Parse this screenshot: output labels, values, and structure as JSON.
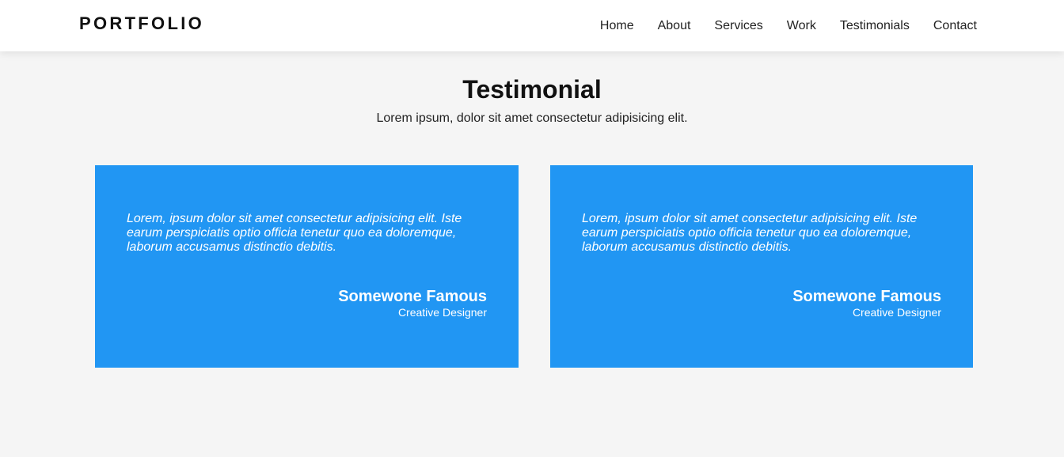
{
  "nav": {
    "logo": "PORTFOLIO",
    "links": [
      "Home",
      "About",
      "Services",
      "Work",
      "Testimonials",
      "Contact"
    ]
  },
  "section": {
    "title": "Testimonial",
    "subtitle": "Lorem ipsum, dolor sit amet consectetur adipisicing elit."
  },
  "testimonials": [
    {
      "quote": "Lorem, ipsum dolor sit amet consectetur adipisicing elit. Iste earum perspiciatis optio officia tenetur quo ea doloremque, laborum accusamus distinctio debitis.",
      "name": "Somewone Famous",
      "role": "Creative Designer"
    },
    {
      "quote": "Lorem, ipsum dolor sit amet consectetur adipisicing elit. Iste earum perspiciatis optio officia tenetur quo ea doloremque, laborum accusamus distinctio debitis.",
      "name": "Somewone Famous",
      "role": "Creative Designer"
    }
  ],
  "colors": {
    "card_background": "#2196f3",
    "page_background": "#f5f5f5",
    "nav_background": "#ffffff"
  }
}
